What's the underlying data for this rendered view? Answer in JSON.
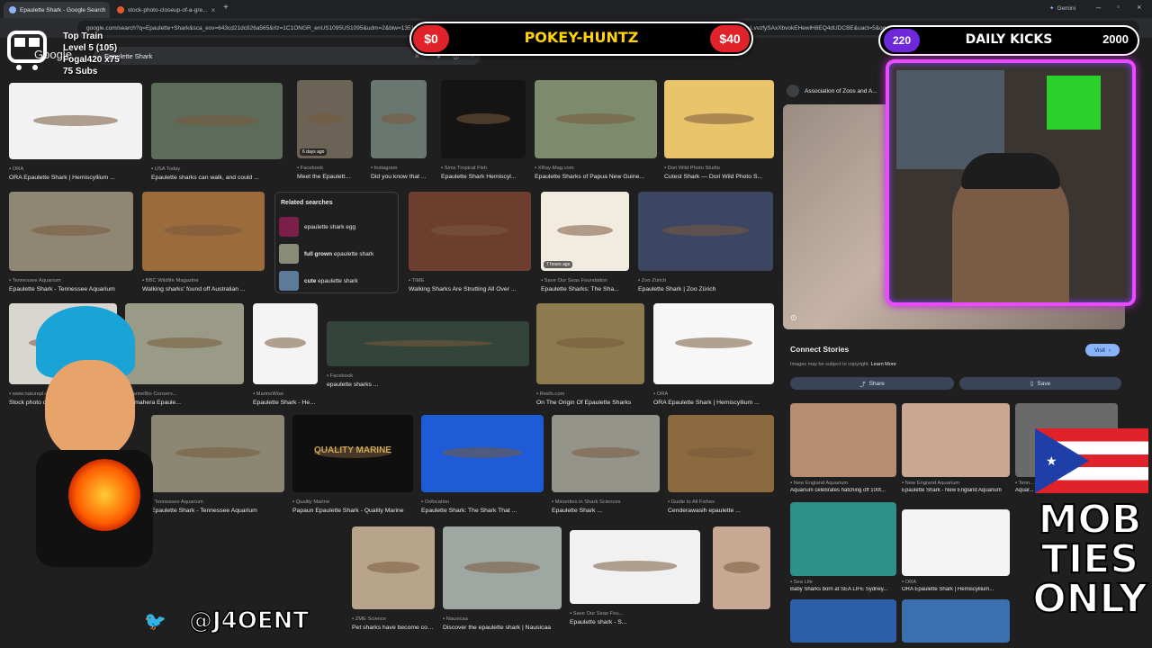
{
  "browser": {
    "tabs": [
      {
        "title": "Epaulette Shark - Google Search",
        "active": true
      },
      {
        "title": "stock-photo-closeup-of-a-gre...",
        "active": false
      }
    ],
    "new_tab": "+",
    "gemini_label": "Gemini",
    "url": "google.com/search?q=Epaulette+Shark&sca_esv=643cd21dc826a565&rlz=1C1ONGR_enUS1095US1095&udm=2&biw=1351&bih=6...&vssid=ANbL-n5zhk2EFFy3qE_q5eC32O4_4DyKA%3A1772296205104&ei=E6jadHwEtr9pOP7bN...&ved=0ahUKEwjRuLvvzfySAxXbvokEHewlH8EQ4dUDCBE&uact=5&oq=Epaulette+Shark&gs_lp=Egtnd"
  },
  "google": {
    "logo": "Google",
    "query": "Epaulette Shark"
  },
  "stream": {
    "train_title": "Top Train",
    "train_level": "Level 5  (105)",
    "train_user": "Fogal420 x75",
    "train_subs": "75 Subs",
    "score_left": "$0",
    "score_title": "POKEY-HUNTZ",
    "score_right": "$40",
    "kicks_left": "220",
    "kicks_title": "DAILY KICKS",
    "kicks_right": "2000",
    "handle": "@J4OENT",
    "mob1": "MOB",
    "mob2": "TIES",
    "mob3": "ONLY"
  },
  "results": [
    {
      "src": "ORA",
      "cap": "ORA Epaulette Shark | Hemiscyllium ...",
      "color": "#f2f2f2"
    },
    {
      "src": "USA Today",
      "cap": "Epaulette sharks can walk, and could ...",
      "color": "#5d6b5a"
    },
    {
      "src": "Facebook",
      "cap": "Meet the Epaulette...",
      "color": "#6b6355",
      "badge": "6 days ago"
    },
    {
      "src": "Instagram",
      "cap": "Did you know that ...",
      "color": "#6a7770"
    },
    {
      "src": "Sims Tropical Fish",
      "cap": "Epaulette Shark Hemiscyl...",
      "color": "#141414"
    },
    {
      "src": "XRay-Mag.com",
      "cap": "Epaulette Sharks of Papua New Guine...",
      "color": "#7e8a6c"
    },
    {
      "src": "Dori Wild Photo Studio",
      "cap": "Cutest Shark — Dori Wild Photo S...",
      "color": "#e9c46a"
    },
    {
      "src": "Tennessee Aquarium",
      "cap": "Epaulette Shark - Tennessee Aquarium",
      "color": "#8f8673"
    },
    {
      "src": "BBC Wildlife Magazine",
      "cap": "Walking sharks' found off Australian ...",
      "color": "#9b6b3c"
    },
    {
      "src": "TIME",
      "cap": "Walking Sharks Are Strutting All Over ...",
      "color": "#6d3e2e"
    },
    {
      "src": "Save Our Seas Foundation",
      "cap": "Epaulette Sharks: The Sha...",
      "color": "#f1ebe0",
      "badge": "7 hours ago"
    },
    {
      "src": "Zoo Zürich",
      "cap": "Epaulette Shark | Zoo Zürich",
      "color": "#3c4663"
    },
    {
      "src": "www.naturepl.com",
      "cap": "Stock photo of Mouth of Epaulette sh...",
      "color": "#d9d6d0"
    },
    {
      "src": "MarineBio Conserv...",
      "cap": "Halmahera Epaule...",
      "color": "#9a9b86"
    },
    {
      "src": "MarineWise",
      "cap": "Epaulette Shark - Hemiscyllium ...",
      "color": "#f4f4f4"
    },
    {
      "src": "Facebook",
      "cap": "epaulette sharks ...",
      "color": "#33443a"
    },
    {
      "src": "Reefs.com",
      "cap": "On The Origin Of Epaulette Sharks",
      "color": "#8d7a4e"
    },
    {
      "src": "ORA",
      "cap": "ORA Epaulette Shark | Hemiscyllium ...",
      "color": "#f7f7f7"
    },
    {
      "src": "Tennessee Aquarium",
      "cap": "Epaulette Shark - Tennessee Aquarium",
      "color": "#8b8772"
    },
    {
      "src": "Quality Marine",
      "cap": "Papaun Epaulette Shark - Quality Marine",
      "color": "#0f0f0f",
      "overlay": "QUALITY MARINE"
    },
    {
      "src": "Oxfocation",
      "cap": "Epaulette Shark: The Shark That ...",
      "color": "#1e5bd6"
    },
    {
      "src": "Minorities in Shark Sciences",
      "cap": "Epaulette Shark ...",
      "color": "#94948a"
    },
    {
      "src": "Guide to All Fishes",
      "cap": "Cenderawasih epaulette ...",
      "color": "#8a6a3e"
    },
    {
      "src": "ZME Science",
      "cap": "Pet sharks have become cool, but is ...",
      "color": "#b8a48a"
    },
    {
      "src": "Nausicaa",
      "cap": "Discover the epaulette shark | Nausicaa",
      "color": "#9fa7a2"
    },
    {
      "src": "Save Our Seas Fou...",
      "cap": "Epaulette shark - S...",
      "color": "#f1f1f1"
    },
    {
      "src": "",
      "cap": "",
      "color": "#c6a893"
    }
  ],
  "related": {
    "title": "Related searches",
    "items": [
      {
        "bold": "",
        "text": "epaulette shark egg",
        "color": "#7a1f4a"
      },
      {
        "bold": "full grown",
        "text": "epaulette shark",
        "color": "#8a8c77"
      },
      {
        "bold": "cute",
        "text": "epaulette shark",
        "color": "#5c7a9a"
      }
    ]
  },
  "side": {
    "source": "Association of Zoos and A...",
    "title": "Connect Stories",
    "visit": "Visit",
    "copyright": "Images may be subject to copyright.",
    "learn_more": "Learn More",
    "share": "Share",
    "save": "Save",
    "more": [
      {
        "src": "New England Aquarium",
        "cap": "Aquarium celebrates hatching off 100t...",
        "color": "#b58d71"
      },
      {
        "src": "New England Aquarium",
        "cap": "Epaulette Shark - New England Aquarium",
        "color": "#c9a793"
      },
      {
        "src": "Tenn...",
        "cap": "Aquar...",
        "color": "#6a6a6a"
      },
      {
        "src": "Sea Life",
        "cap": "Baby Sharks born at SEA LIFE Sydney...",
        "color": "#2f8f8a"
      },
      {
        "src": "ORA",
        "cap": "ORA Epaulette Shark | Hemiscyllium...",
        "color": "#f4f4f4"
      },
      {
        "src": "",
        "cap": "",
        "color": "#2c5fa8"
      },
      {
        "src": "",
        "cap": "",
        "color": "#3b6fb0"
      }
    ]
  },
  "colors": {
    "accent": "#8ab4f8",
    "magenta": "#e94bff",
    "gold": "#ffd400",
    "red": "#e0232b"
  }
}
